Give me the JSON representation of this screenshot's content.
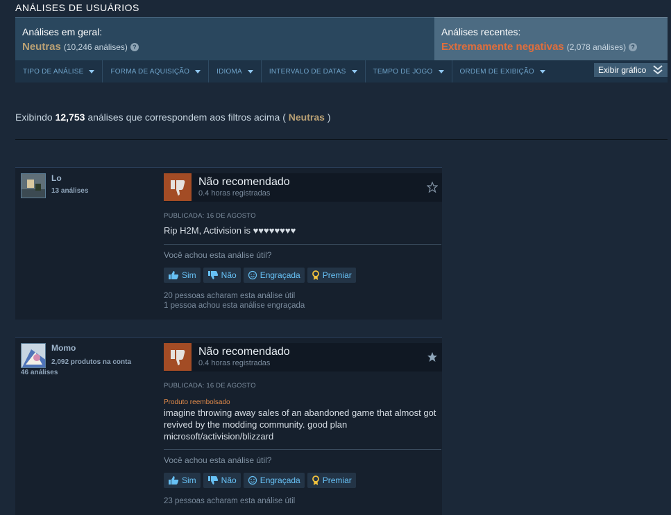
{
  "section_title": "ANÁLISES DE USUÁRIOS",
  "summary": {
    "general_label": "Análises em geral:",
    "general_value": "Neutras",
    "general_count": "(10,246 análises)",
    "recent_label": "Análises recentes:",
    "recent_value": "Extremamente negativas",
    "recent_count": "(2,078 análises)",
    "help_glyph": "?",
    "colors": {
      "neutral": "#b9a074",
      "negative": "#e06e3c"
    }
  },
  "filters": [
    {
      "label": "TIPO DE ANÁLISE"
    },
    {
      "label": "FORMA DE AQUISIÇÃO"
    },
    {
      "label": "IDIOMA"
    },
    {
      "label": "INTERVALO DE DATAS"
    },
    {
      "label": "TEMPO DE JOGO"
    },
    {
      "label": "ORDEM DE EXIBIÇÃO"
    }
  ],
  "graph_button": "Exibir gráfico",
  "showing": {
    "prefix": "Exibindo",
    "count": "12,753",
    "middle": "análises que correspondem aos filtros acima (",
    "filter": "Neutras",
    "suffix": ")"
  },
  "reviews": [
    {
      "author": "Lo",
      "author_line1": "13 análises",
      "author_line2": "",
      "verdict": "Não recomendado",
      "hours": "0.4 horas registradas",
      "posted": "PUBLICADA: 16 DE AGOSTO",
      "refunded": "",
      "text": "Rip H2M, Activision is ♥♥♥♥♥♥♥♥",
      "helpful_question": "Você achou esta análise útil?",
      "buttons": {
        "yes": "Sim",
        "no": "Não",
        "funny": "Engraçada",
        "award": "Premiar"
      },
      "vote_info_1": "20 pessoas acharam esta análise útil",
      "vote_info_2": "1 pessoa achou esta análise engraçada",
      "starred": false
    },
    {
      "author": "Momo",
      "author_line1": "2,092 produtos na conta",
      "author_line2": "46 análises",
      "verdict": "Não recomendado",
      "hours": "0.4 horas registradas",
      "posted": "PUBLICADA: 16 DE AGOSTO",
      "refunded": "Produto reembolsado",
      "text": "imagine throwing away sales of an abandoned game that almost got revived by the modding community. good plan microsoft/activision/blizzard",
      "helpful_question": "Você achou esta análise útil?",
      "buttons": {
        "yes": "Sim",
        "no": "Não",
        "funny": "Engraçada",
        "award": "Premiar"
      },
      "vote_info_1": "23 pessoas acharam esta análise útil",
      "vote_info_2": "",
      "starred": true
    }
  ],
  "icons": {
    "thumb": "thumbs-down-icon",
    "star": "star-icon",
    "yes": "thumbs-up-icon",
    "no": "thumbs-down-icon",
    "funny": "smiley-icon",
    "award": "award-icon",
    "graph": "double-chevron-down-icon"
  }
}
